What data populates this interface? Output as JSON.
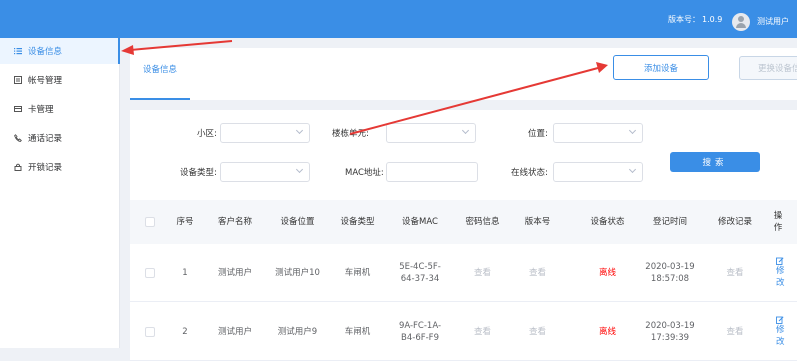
{
  "header": {
    "version_label": "版本号：",
    "version": "1.0.9",
    "user_name": "测试用户"
  },
  "sidebar": {
    "items": [
      {
        "label": "设备信息",
        "icon": "list-icon",
        "active": true
      },
      {
        "label": "帐号管理",
        "icon": "account-icon",
        "active": false
      },
      {
        "label": "卡管理",
        "icon": "card-icon",
        "active": false
      },
      {
        "label": "通话记录",
        "icon": "phone-icon",
        "active": false
      },
      {
        "label": "开锁记录",
        "icon": "lock-icon",
        "active": false
      }
    ]
  },
  "tabs": {
    "active": "设备信息"
  },
  "toolbar": {
    "add_label": "添加设备",
    "replace_label": "更换设备信"
  },
  "filters": {
    "community_label": "小区:",
    "building_label": "楼栋单元:",
    "location_label": "位置:",
    "device_type_label": "设备类型:",
    "mac_label": "MAC地址:",
    "online_label": "在线状态:",
    "search_label": "搜索"
  },
  "table": {
    "columns": [
      "序号",
      "客户名称",
      "设备位置",
      "设备类型",
      "设备MAC",
      "密码信息",
      "版本号",
      "设备状态",
      "登记时间",
      "修改记录",
      "操作"
    ],
    "rows": [
      {
        "index": "1",
        "customer": "测试用户",
        "location": "测试用户10",
        "type": "车闸机",
        "mac1": "5E-4C-5F-",
        "mac2": "64-37-34",
        "password": "查看",
        "version": "查看",
        "status": "离线",
        "date": "2020-03-19",
        "time": "18:57:08",
        "history": "查看",
        "op1": "修",
        "op2": "改"
      },
      {
        "index": "2",
        "customer": "测试用户",
        "location": "测试用户9",
        "type": "车闸机",
        "mac1": "9A-FC-1A-",
        "mac2": "B4-6F-F9",
        "password": "查看",
        "version": "查看",
        "status": "离线",
        "date": "2020-03-19",
        "time": "17:39:39",
        "history": "查看",
        "op1": "修",
        "op2": "改"
      }
    ]
  },
  "colors": {
    "primary": "#3a8ee6",
    "annotation_arrow": "#e53935",
    "offline": "#ff0000"
  }
}
